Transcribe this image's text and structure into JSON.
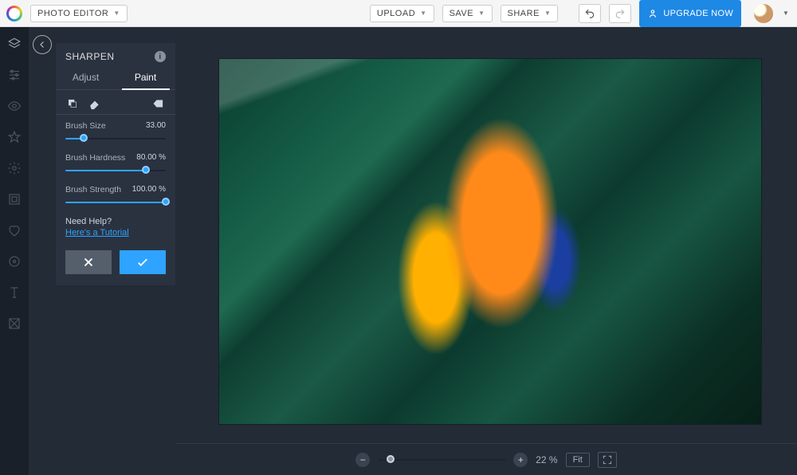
{
  "topbar": {
    "app_name": "PHOTO EDITOR",
    "upload": "UPLOAD",
    "save": "SAVE",
    "share": "SHARE",
    "upgrade": "UPGRADE NOW"
  },
  "panel": {
    "title": "SHARPEN",
    "tabs": {
      "adjust": "Adjust",
      "paint": "Paint",
      "active": "paint"
    },
    "sliders": {
      "brush_size": {
        "label": "Brush Size",
        "value": "33.00",
        "pct": 18
      },
      "brush_hardness": {
        "label": "Brush Hardness",
        "value": "80.00 %",
        "pct": 80
      },
      "brush_strength": {
        "label": "Brush Strength",
        "value": "100.00 %",
        "pct": 100
      }
    },
    "help": {
      "question": "Need Help?",
      "link": "Here's a Tutorial"
    }
  },
  "bottombar": {
    "zoom_pct_display": "22 %",
    "zoom_slider_pct": 10,
    "fit_label": "Fit"
  },
  "toolrail_items": [
    "layers",
    "adjust",
    "view",
    "favorite",
    "settings",
    "frame",
    "heart",
    "gear2",
    "text",
    "texture"
  ]
}
